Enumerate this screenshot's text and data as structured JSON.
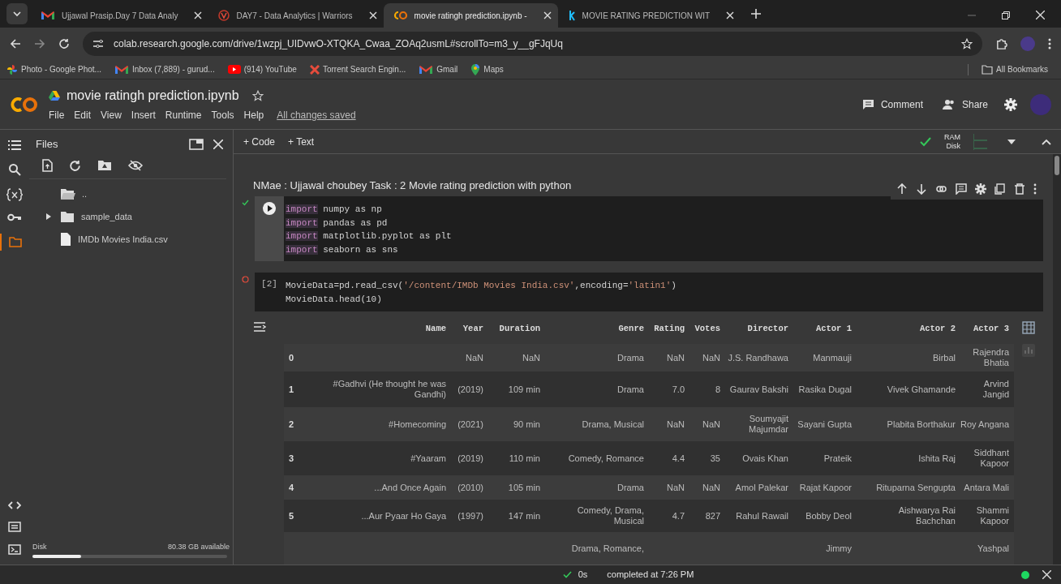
{
  "browser": {
    "tabs": [
      {
        "title": "Ujjawal Prasip.Day 7 Data Analy",
        "selected": false
      },
      {
        "title": "DAY7 - Data Analytics | Warriors",
        "selected": false
      },
      {
        "title": "movie ratingh prediction.ipynb -",
        "selected": true
      },
      {
        "title": "MOVIE RATING PREDICTION WIT",
        "selected": false
      }
    ],
    "url": "colab.research.google.com/drive/1wzpj_UIDvwO-XTQKA_Cwaa_ZOAq2usmL#scrollTo=m3_y__gFJqUq",
    "bookmarks": [
      {
        "label": "Photo - Google Phot..."
      },
      {
        "label": "Inbox (7,889) - gurud..."
      },
      {
        "label": "(914) YouTube"
      },
      {
        "label": "Torrent Search Engin..."
      },
      {
        "label": "Gmail"
      },
      {
        "label": "Maps"
      }
    ],
    "all_bookmarks": "All Bookmarks"
  },
  "notebook": {
    "title": "movie ratingh prediction.ipynb",
    "menu": [
      "File",
      "Edit",
      "View",
      "Insert",
      "Runtime",
      "Tools",
      "Help"
    ],
    "save_status": "All changes saved",
    "comment": "Comment",
    "share": "Share"
  },
  "toolbar": {
    "add_code": "+ Code",
    "add_text": "+ Text",
    "ram": "RAM",
    "disk": "Disk"
  },
  "files_panel": {
    "title": "Files",
    "items": [
      {
        "kind": "parent",
        "name": ".."
      },
      {
        "kind": "folder",
        "name": "sample_data",
        "expanded": false
      },
      {
        "kind": "file",
        "name": "IMDb Movies India.csv"
      }
    ],
    "disk": {
      "label": "Disk",
      "available": "80.38 GB available",
      "level": 0.25
    }
  },
  "text_cell": "NMae : Ujjawal choubey Task : 2 Movie rating prediction with python",
  "code_cells": [
    {
      "lines": [
        [
          {
            "kind": "keyword",
            "text": "import"
          },
          {
            "kind": "plain",
            "text": " numpy as np"
          }
        ],
        [
          {
            "kind": "keyword",
            "text": "import"
          },
          {
            "kind": "plain",
            "text": " pandas as pd"
          }
        ],
        [
          {
            "kind": "keyword",
            "text": "import"
          },
          {
            "kind": "plain",
            "text": " matplotlib.pyplot as plt"
          }
        ],
        [
          {
            "kind": "keyword",
            "text": "import"
          },
          {
            "kind": "plain",
            "text": " seaborn as sns"
          }
        ]
      ]
    },
    {
      "count": "[2]",
      "lines": [
        [
          {
            "kind": "plain",
            "text": "MovieData=pd.read_csv("
          },
          {
            "kind": "string",
            "text": "'/content/IMDb Movies India.csv'"
          },
          {
            "kind": "plain",
            "text": ",encoding="
          },
          {
            "kind": "string",
            "text": "'latin1'"
          },
          {
            "kind": "plain",
            "text": ")"
          }
        ],
        [
          {
            "kind": "plain",
            "text": "MovieData.head(10)"
          }
        ]
      ]
    }
  ],
  "table": {
    "columns": [
      "Name",
      "Year",
      "Duration",
      "Genre",
      "Rating",
      "Votes",
      "Director",
      "Actor 1",
      "Actor 2",
      "Actor 3"
    ],
    "rows": [
      {
        "index": "0",
        "cells": [
          null,
          "NaN",
          "NaN",
          "Drama",
          "NaN",
          "NaN",
          "J.S. Randhawa",
          "Manmauji",
          "Birbal",
          "Rajendra Bhatia"
        ]
      },
      {
        "index": "1",
        "cells": [
          "#Gadhvi (He thought he was Gandhi)",
          "(2019)",
          "109 min",
          "Drama",
          "7.0",
          "8",
          "Gaurav Bakshi",
          "Rasika Dugal",
          "Vivek Ghamande",
          "Arvind Jangid"
        ]
      },
      {
        "index": "2",
        "cells": [
          "#Homecoming",
          "(2021)",
          "90 min",
          "Drama, Musical",
          "NaN",
          "NaN",
          "Soumyajit Majumdar",
          "Sayani Gupta",
          "Plabita Borthakur",
          "Roy Angana"
        ]
      },
      {
        "index": "3",
        "cells": [
          "#Yaaram",
          "(2019)",
          "110 min",
          "Comedy, Romance",
          "4.4",
          "35",
          "Ovais Khan",
          "Prateik",
          "Ishita Raj",
          "Siddhant Kapoor"
        ]
      },
      {
        "index": "4",
        "cells": [
          "...And Once Again",
          "(2010)",
          "105 min",
          "Drama",
          "NaN",
          "NaN",
          "Amol Palekar",
          "Rajat Kapoor",
          "Rituparna Sengupta",
          "Antara Mali"
        ]
      },
      {
        "index": "5",
        "cells": [
          "...Aur Pyaar Ho Gaya",
          "(1997)",
          "147 min",
          "Comedy, Drama, Musical",
          "4.7",
          "827",
          "Rahul Rawail",
          "Bobby Deol",
          "Aishwarya Rai Bachchan",
          "Shammi Kapoor"
        ]
      },
      {
        "index": null,
        "cells": [
          null,
          null,
          null,
          "Drama, Romance,",
          null,
          null,
          null,
          "Jimmy",
          null,
          "Yashpal"
        ]
      }
    ]
  },
  "status_bar": {
    "duration": "0s",
    "message": "completed at 7:26 PM"
  }
}
